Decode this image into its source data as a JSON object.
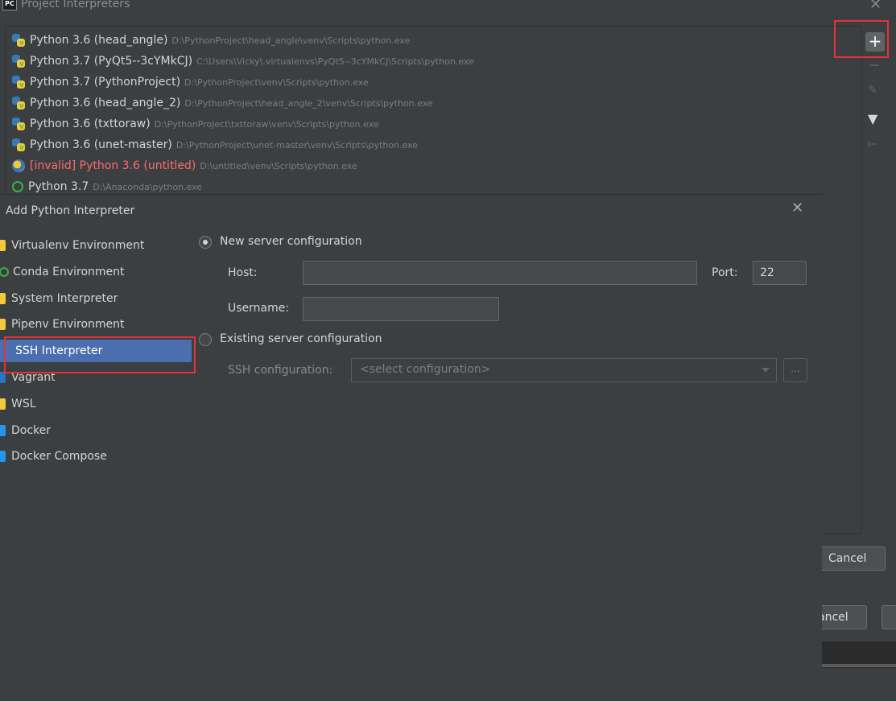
{
  "back_window": {
    "title": "Project Interpreters",
    "close_glyph": "✕",
    "logo_text": "PC",
    "interpreters": [
      {
        "name": "Python 3.6 (head_angle)",
        "path": "D:\\PythonProject\\head_angle\\venv\\Scripts\\python.exe",
        "icon": "python-venv-icon",
        "invalid": false
      },
      {
        "name": "Python 3.7 (PyQt5--3cYMkCJ)",
        "path": "C:\\Users\\Vicky\\.virtualenvs\\PyQt5--3cYMkCJ\\Scripts\\python.exe",
        "icon": "python-venv-icon",
        "invalid": false
      },
      {
        "name": "Python 3.7 (PythonProject)",
        "path": "D:\\PythonProject\\venv\\Scripts\\python.exe",
        "icon": "python-venv-icon",
        "invalid": false
      },
      {
        "name": "Python 3.6 (head_angle_2)",
        "path": "D:\\PythonProject\\head_angle_2\\venv\\Scripts\\python.exe",
        "icon": "python-venv-icon",
        "invalid": false
      },
      {
        "name": "Python 3.6 (txttoraw)",
        "path": "D:\\PythonProject\\txttoraw\\venv\\Scripts\\python.exe",
        "icon": "python-venv-icon",
        "invalid": false
      },
      {
        "name": "Python 3.6 (unet-master)",
        "path": "D:\\PythonProject\\unet-master\\venv\\Scripts\\python.exe",
        "icon": "python-venv-icon",
        "invalid": false
      },
      {
        "name": "[invalid] Python 3.6 (untitled)",
        "path": "D:\\untitled\\venv\\Scripts\\python.exe",
        "icon": "invalid-python-icon",
        "invalid": true
      },
      {
        "name": "Python 3.7",
        "path": "D:\\Anaconda\\python.exe",
        "icon": "conda-icon",
        "invalid": false
      }
    ],
    "toolbar": {
      "add_glyph": "+",
      "edit_glyph": "✎",
      "filter_glyph": "▼",
      "tree_glyph": "⊢"
    },
    "cancel_label": "Cancel",
    "cancel2_label": "ancel"
  },
  "add_dialog": {
    "title": "Add Python Interpreter",
    "close_glyph": "✕",
    "nav": [
      {
        "label": "Virtualenv Environment",
        "icon": "virtualenv-icon",
        "active": false
      },
      {
        "label": "Conda Environment",
        "icon": "conda-icon",
        "active": false
      },
      {
        "label": "System Interpreter",
        "icon": "python-icon",
        "active": false
      },
      {
        "label": "Pipenv Environment",
        "icon": "pipenv-icon",
        "active": false
      },
      {
        "label": "SSH Interpreter",
        "icon": "ssh-icon",
        "active": true
      },
      {
        "label": "Vagrant",
        "icon": "vagrant-icon",
        "active": false
      },
      {
        "label": "WSL",
        "icon": "wsl-icon",
        "active": false
      },
      {
        "label": "Docker",
        "icon": "docker-icon",
        "active": false
      },
      {
        "label": "Docker Compose",
        "icon": "docker-compose-icon",
        "active": false
      }
    ],
    "new_server": {
      "label": "New server configuration",
      "selected": true,
      "host_label": "Host:",
      "host_value": "",
      "port_label": "Port:",
      "port_value": "22",
      "username_label": "Username:",
      "username_value": ""
    },
    "existing_server": {
      "label": "Existing server configuration",
      "selected": false,
      "ssh_config_label": "SSH configuration:",
      "ssh_config_placeholder": "<select configuration>",
      "browse_label": "..."
    }
  },
  "colors": {
    "background": "#3c3f41",
    "selection": "#4b6eaf",
    "invalid_text": "#ff6b68",
    "highlight_box": "#e5323a"
  }
}
